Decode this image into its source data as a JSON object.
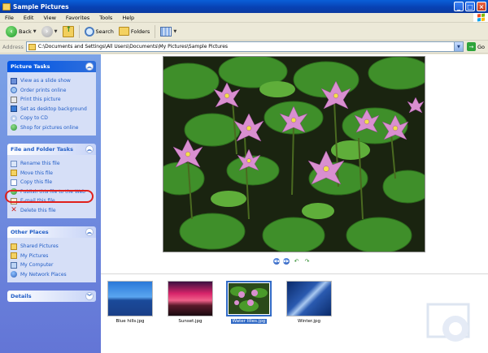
{
  "window": {
    "title": "Sample Pictures"
  },
  "menu": [
    "File",
    "Edit",
    "View",
    "Favorites",
    "Tools",
    "Help"
  ],
  "toolbar": {
    "back": "Back",
    "search": "Search",
    "folders": "Folders"
  },
  "address": {
    "label": "Address",
    "value": "C:\\Documents and Settings\\All Users\\Documents\\My Pictures\\Sample Pictures",
    "go": "Go"
  },
  "panels": {
    "picture_tasks": {
      "title": "Picture Tasks",
      "items": [
        "View as a slide show",
        "Order prints online",
        "Print this picture",
        "Set as desktop background",
        "Copy to CD",
        "Shop for pictures online"
      ]
    },
    "file_tasks": {
      "title": "File and Folder Tasks",
      "items": [
        "Rename this file",
        "Move this file",
        "Copy this file",
        "Publish this file to the Web",
        "E-mail this file",
        "Delete this file"
      ]
    },
    "other_places": {
      "title": "Other Places",
      "items": [
        "Shared Pictures",
        "My Pictures",
        "My Computer",
        "My Network Places"
      ]
    },
    "details": {
      "title": "Details"
    }
  },
  "thumbnails": [
    "Blue hills.jpg",
    "Sunset.jpg",
    "Water lilies.jpg",
    "Winter.jpg"
  ],
  "selected_thumbnail": "Water lilies.jpg",
  "colors": {
    "titlebar": "#0842b4",
    "taskpane": "#7ba2e7",
    "highlight_ring": "#e0201c",
    "link": "#215dc6"
  }
}
